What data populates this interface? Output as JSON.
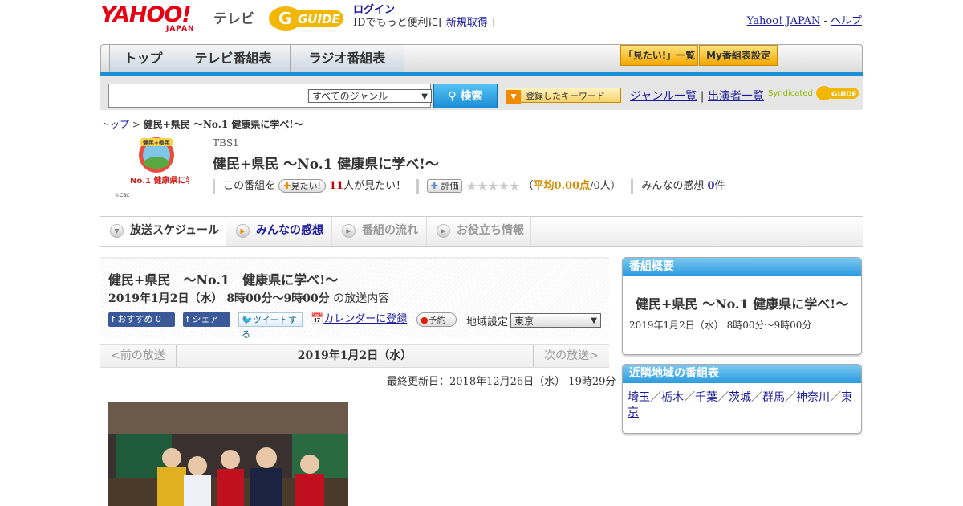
{
  "header": {
    "logo_text": "YAHOO!",
    "logo_sub": "JAPAN",
    "service_label": "テレビ",
    "gguide_text": "GUIDE",
    "login_link": "ログイン",
    "login_desc": "IDでもっと便利に[",
    "signup_link": "新規取得",
    "login_close": "]",
    "yahoo_link": "Yahoo! JAPAN",
    "sep": "-",
    "help_link": "ヘルプ"
  },
  "nav": {
    "tabs": [
      "トップ",
      "テレビ番組表",
      "ラジオ番組表"
    ],
    "mitai_list": "「見たい!」一覧",
    "my_schedule": "My番組表設定"
  },
  "search": {
    "genre_selected": "すべてのジャンル",
    "search_button": "検索",
    "keyword_button": "登録したキーワード",
    "genre_list_link": "ジャンル一覧",
    "divider": "|",
    "performer_link": "出演者一覧",
    "syndicated": "Syndicated"
  },
  "breadcrumb": {
    "top": "トップ",
    "sep": ">",
    "current": "健民+県民 ～No.1 健康県に学べ!～"
  },
  "program": {
    "logo_text": "健民+県民",
    "logo_sub": "No.1 健康県に学べ!",
    "logo_copyright": "©CBC",
    "channel": "TBS1",
    "title": "健民+県民 ～No.1 健康県に学べ!～",
    "stats": {
      "watch_prefix": "この番組を",
      "watch_button": "見たい!",
      "watch_count": "11",
      "watch_suffix": "人が見たい！",
      "rating_button": "評価",
      "stars": "★★★★★",
      "rating_open": "（",
      "rating_avg_label": "平均0.00点",
      "rating_people": "/0人）",
      "impressions_label": "みんなの感想",
      "impressions_count": "0",
      "impressions_suffix": "件"
    }
  },
  "content_tabs": [
    "放送スケジュール",
    "みんなの感想",
    "番組の流れ",
    "お役立ち情報"
  ],
  "schedule": {
    "title": "健民+県民　～No.1　健康県に学べ!～",
    "datetime": "2019年1月2日（水）  8時00分～9時00分",
    "datetime_suffix": "の放送内容",
    "recommend": "おすすめ",
    "recommend_count": "0",
    "share": "シェア",
    "tweet": "ツイートする",
    "calendar": "カレンダーに登録",
    "reserve": "予約",
    "region_label": "地域設定",
    "region_selected": "東京"
  },
  "pager": {
    "prev": "<前の放送",
    "current": "2019年1月2日（水）",
    "next": "次の放送>"
  },
  "updated": "最終更新日：2018年12月26日（水）  19時29分",
  "overview": {
    "header": "番組概要",
    "title": "健民+県民 ～No.1 健康県に学べ!～",
    "time": "2019年1月2日（水）  8時00分～9時00分"
  },
  "neighbors": {
    "header": "近隣地域の番組表",
    "regions": [
      "埼玉",
      "栃木",
      "千葉",
      "茨城",
      "群馬",
      "神奈川",
      "東京"
    ],
    "sep": "／"
  }
}
